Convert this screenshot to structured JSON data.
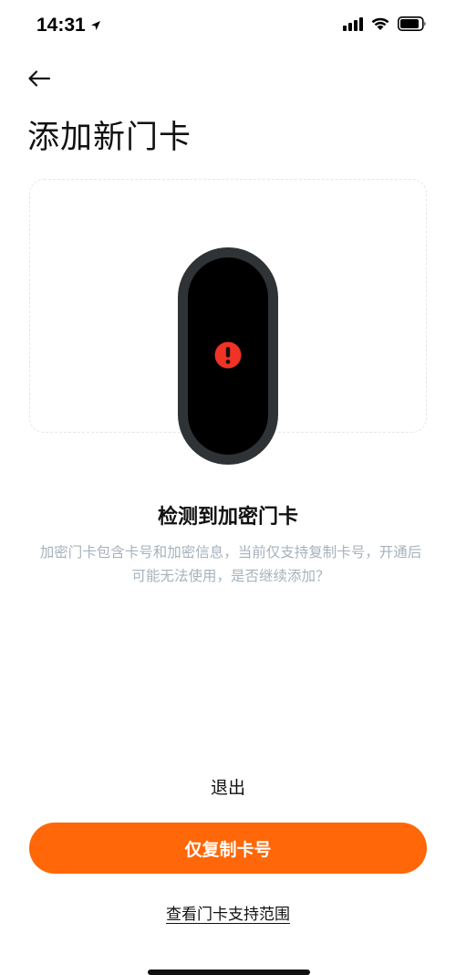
{
  "status_bar": {
    "time": "14:31",
    "location_icon": "location-arrow-icon",
    "signal_icon": "cellular-signal-icon",
    "wifi_icon": "wifi-icon",
    "battery_icon": "battery-icon"
  },
  "header": {
    "back_icon": "back-arrow-icon",
    "title": "添加新门卡"
  },
  "device": {
    "illustration": "smart-band",
    "alert_icon": "exclamation-alert-icon",
    "alert_color": "#f03324"
  },
  "message": {
    "title": "检测到加密门卡",
    "description": "加密门卡包含卡号和加密信息，当前仅支持复制卡号，开通后可能无法使用，是否继续添加？"
  },
  "actions": {
    "exit_label": "退出",
    "copy_card_number_label": "仅复制卡号",
    "support_scope_label": "查看门卡支持范围"
  },
  "colors": {
    "accent": "#ff6708",
    "description_text": "#a7b2bc",
    "band_frame": "#2f3336"
  }
}
